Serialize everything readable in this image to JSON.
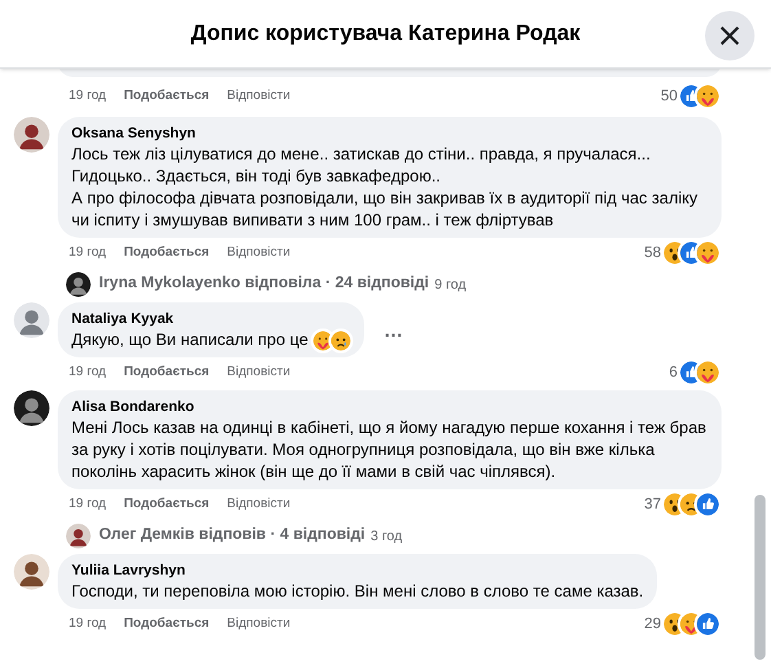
{
  "dialog": {
    "title": "Допис користувача Катерина Родак"
  },
  "comments": [
    {
      "kind": "meta",
      "time": "19 год",
      "like": "Подобається",
      "reply": "Відповісти",
      "count": "50",
      "reactions": [
        {
          "kind": "like"
        },
        {
          "kind": "care"
        }
      ]
    },
    {
      "kind": "comment",
      "author": "Oksana Senyshyn",
      "text": "Лось теж ліз цілуватися до мене.. затискав до стіни.. правда, я пручалася...\nГидоцько.. Здається, він тоді був завкафедрою..\nА про філософа дівчата розповідали, що він закривав їх в аудиторії під час заліку чи іспиту і змушував випивати з ним 100 грам.. і теж фліртував",
      "time": "19 год",
      "like": "Подобається",
      "reply": "Відповісти",
      "count": "58",
      "reactions": [
        {
          "kind": "wow"
        },
        {
          "kind": "like"
        },
        {
          "kind": "care"
        }
      ]
    },
    {
      "kind": "replies",
      "author": "Iryna Mykolayenko відповіла",
      "replies": "· 24 відповіді",
      "time": "9 год"
    },
    {
      "kind": "comment",
      "author": "Nataliya Kyyak",
      "text": "Дякую, що Ви написали про це",
      "emoji": [
        {
          "kind": "care"
        },
        {
          "kind": "sad"
        }
      ],
      "menu": "…",
      "time": "19 год",
      "like": "Подобається",
      "reply": "Відповісти",
      "count": "6",
      "reactions": [
        {
          "kind": "like"
        },
        {
          "kind": "care"
        }
      ]
    },
    {
      "kind": "comment",
      "author": "Alisa Bondarenko",
      "text": "Мені Лось казав на одинці в кабінеті, що я йому нагадую перше кохання і теж брав за руку і хотів поцілувати. Моя одногрупниця розповідала, що він вже кілька поколінь харасить жінок (він ще до її мами в свій час чіплявся).",
      "time": "19 год",
      "like": "Подобається",
      "reply": "Відповісти",
      "count": "37",
      "reactions": [
        {
          "kind": "wow"
        },
        {
          "kind": "sad"
        },
        {
          "kind": "like"
        }
      ]
    },
    {
      "kind": "replies",
      "author": "Олег Демків відповів",
      "replies": "· 4 відповіді",
      "time": "3 год"
    },
    {
      "kind": "comment",
      "author": "Yuliia Lavryshyn",
      "text": "Господи, ти переповіла мою історію. Він мені слово в слово те саме казав.",
      "time": "19 год",
      "like": "Подобається",
      "reply": "Відповісти",
      "count": "29",
      "reactions": [
        {
          "kind": "wow"
        },
        {
          "kind": "care"
        },
        {
          "kind": "like"
        }
      ]
    }
  ]
}
